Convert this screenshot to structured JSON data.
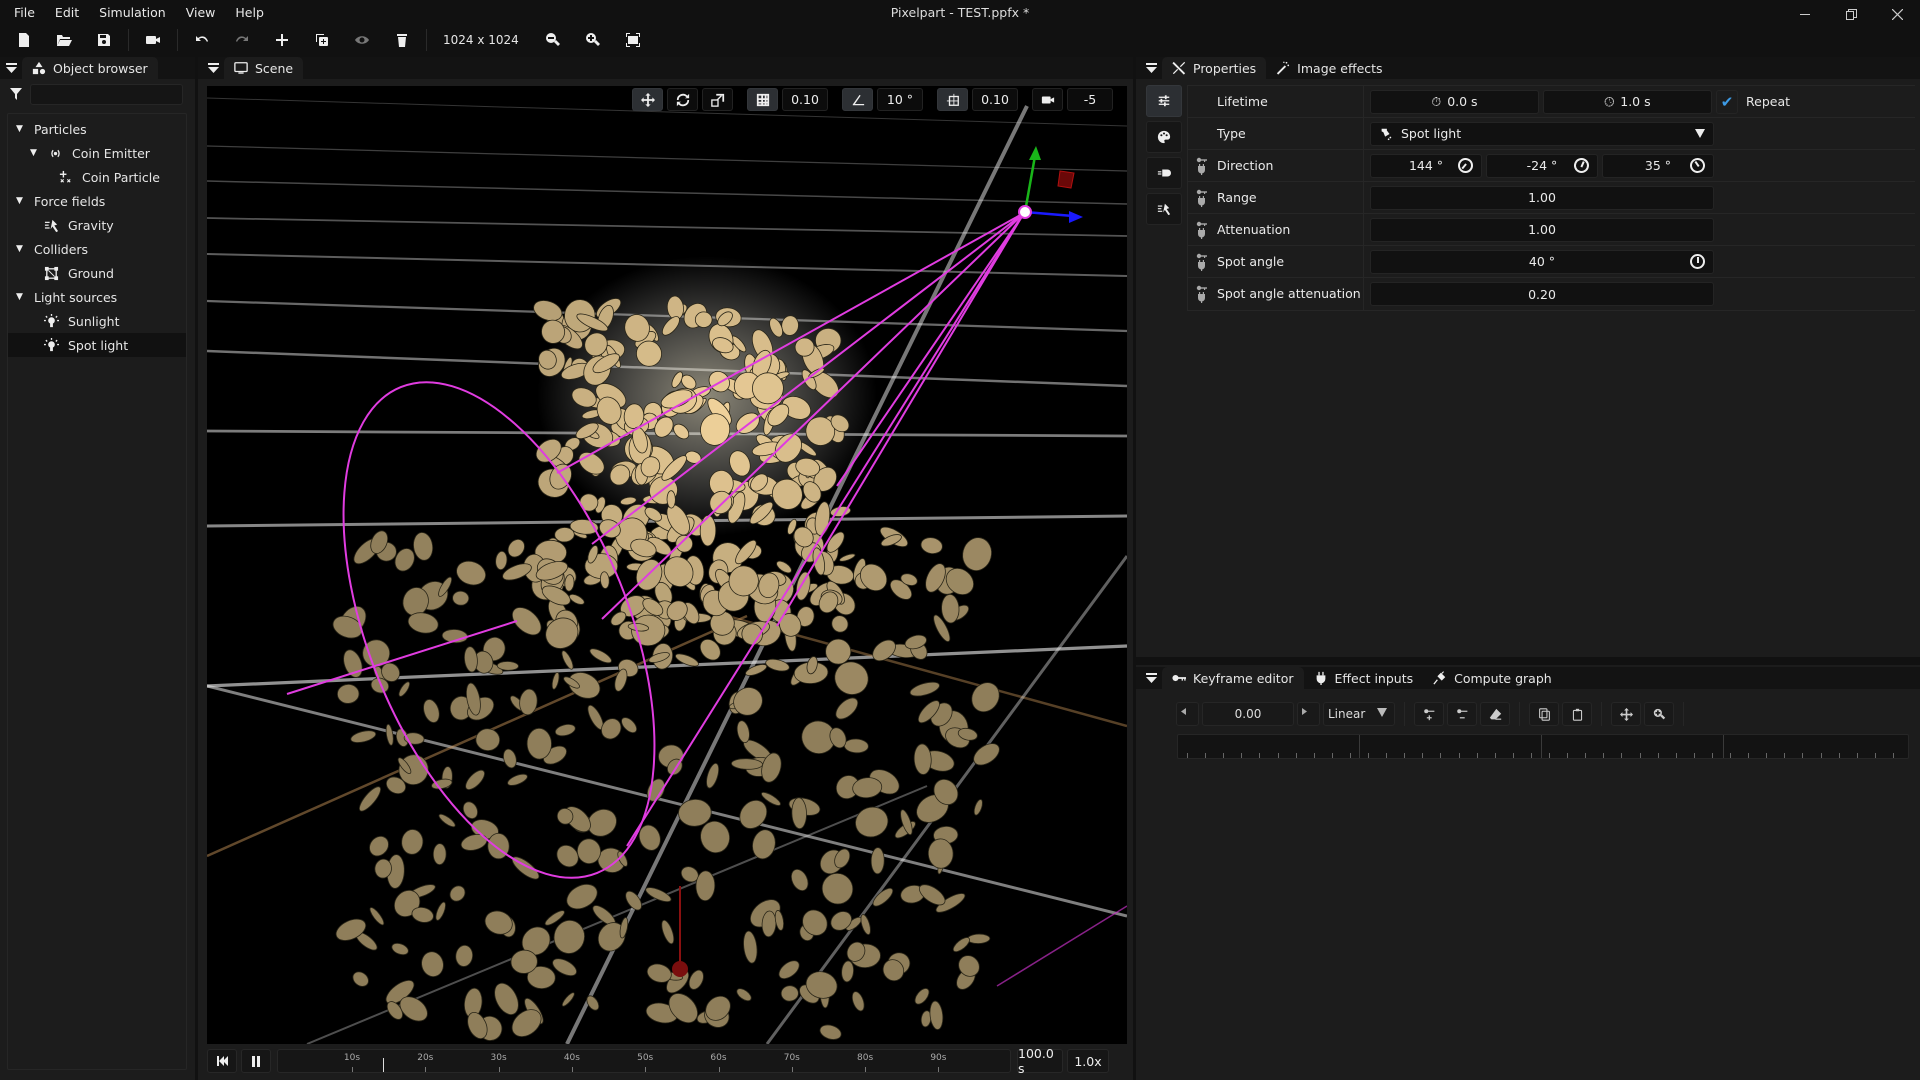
{
  "app": {
    "title": "Pixelpart - TEST.ppfx *",
    "window_controls": [
      "minimize-icon",
      "restore-icon",
      "close-icon"
    ]
  },
  "menu": [
    "File",
    "Edit",
    "Simulation",
    "View",
    "Help"
  ],
  "toolbar": {
    "buttons": [
      {
        "name": "new-file",
        "icon": "file-icon"
      },
      {
        "name": "open-file",
        "icon": "folder-open-icon"
      },
      {
        "name": "save-file",
        "icon": "save-icon"
      },
      {
        "name": "render",
        "icon": "video-camera-icon"
      },
      {
        "name": "undo",
        "icon": "undo-icon"
      },
      {
        "name": "redo",
        "icon": "redo-icon"
      },
      {
        "name": "add",
        "icon": "plus-icon"
      },
      {
        "name": "duplicate",
        "icon": "duplicate-icon"
      },
      {
        "name": "toggle-visibility",
        "icon": "eye-icon"
      },
      {
        "name": "delete",
        "icon": "trash-icon"
      }
    ],
    "resolution": "1024 x 1024",
    "zoom_buttons": [
      "zoom-out-icon",
      "zoom-in-icon",
      "fit-view-icon"
    ]
  },
  "object_browser": {
    "tab_label": "Object browser",
    "filter_value": "",
    "tree": [
      {
        "label": "Particles",
        "level": 0,
        "expandable": true,
        "icon": null
      },
      {
        "label": "Coin Emitter",
        "level": 1,
        "expandable": true,
        "icon": "emitter-icon"
      },
      {
        "label": "Coin Particle",
        "level": 2,
        "expandable": false,
        "icon": "particle-type-icon"
      },
      {
        "label": "Force fields",
        "level": 0,
        "expandable": true,
        "icon": null
      },
      {
        "label": "Gravity",
        "level": 1,
        "expandable": false,
        "icon": "force-field-icon"
      },
      {
        "label": "Colliders",
        "level": 0,
        "expandable": true,
        "icon": null
      },
      {
        "label": "Ground",
        "level": 1,
        "expandable": false,
        "icon": "collider-icon"
      },
      {
        "label": "Light sources",
        "level": 0,
        "expandable": true,
        "icon": null
      },
      {
        "label": "Sunlight",
        "level": 1,
        "expandable": false,
        "icon": "light-bulb-icon"
      },
      {
        "label": "Spot light",
        "level": 1,
        "expandable": false,
        "icon": "light-bulb-icon",
        "selected": true
      }
    ]
  },
  "scene": {
    "tab_label": "Scene",
    "view_tools": {
      "grid_size": "0.10",
      "angle_snap": "10 °",
      "position_snap": "0.10",
      "camera_value": "-5"
    },
    "timeline": {
      "tick_labels": [
        "10s",
        "20s",
        "30s",
        "40s",
        "50s",
        "60s",
        "70s",
        "80s",
        "90s"
      ],
      "duration_max_s": 100,
      "playhead_s": 14.2,
      "duration": "100.0 s",
      "speed": "1.0x"
    }
  },
  "properties": {
    "tabs": [
      "Properties",
      "Image effects"
    ],
    "side_tabs": [
      "properties-sliders-icon",
      "palette-icon",
      "material-icon",
      "force-icon"
    ],
    "lifetime": {
      "label": "Lifetime",
      "start": "0.0 s",
      "duration": "1.0 s",
      "repeat_label": "Repeat",
      "repeat_checked": true
    },
    "type": {
      "label": "Type",
      "value": "Spot light"
    },
    "direction": {
      "label": "Direction",
      "values": [
        "144 °",
        "-24 °",
        "35 °"
      ]
    },
    "range": {
      "label": "Range",
      "value": "1.00"
    },
    "attenuation": {
      "label": "Attenuation",
      "value": "1.00"
    },
    "spot_angle": {
      "label": "Spot angle",
      "value": "40 °"
    },
    "spot_angle_attenuation": {
      "label": "Spot angle attenuation",
      "value": "0.20"
    }
  },
  "keyframe_panel": {
    "tabs": [
      "Keyframe editor",
      "Effect inputs",
      "Compute graph"
    ],
    "value": "0.00",
    "interpolation": "Linear"
  },
  "colors": {
    "accent_check": "#3d9be6",
    "cone": "#e03ce0",
    "gizmo_x": "#1a1aff",
    "gizmo_y": "#19b519",
    "gizmo_z": "#b01010"
  }
}
